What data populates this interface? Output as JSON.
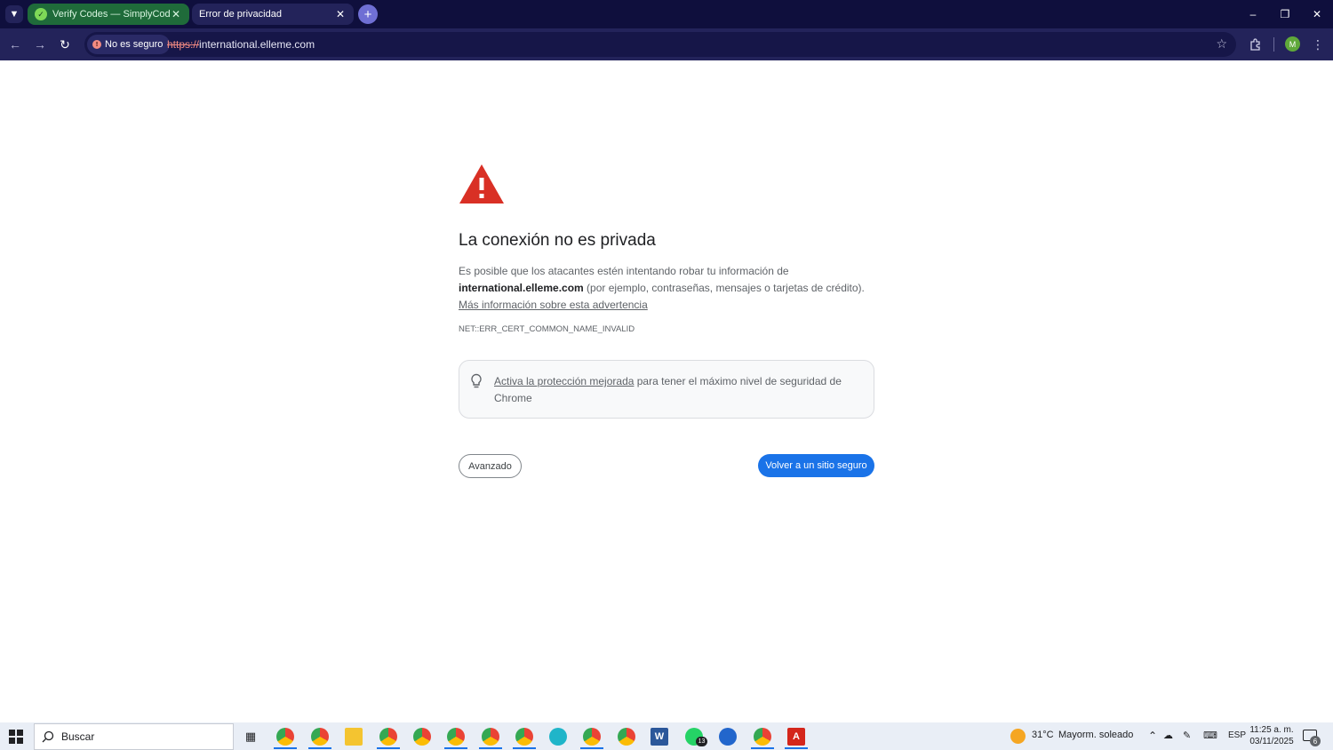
{
  "browser": {
    "tabs": [
      {
        "title": "Verify Codes — SimplyCodes",
        "favicon": "simplycodes-check-icon",
        "active": false
      },
      {
        "title": "Error de privacidad",
        "favicon": "",
        "active": true
      }
    ],
    "security_chip": "No es seguro",
    "url_scheme": "https://",
    "url_host": "international.elleme.com",
    "profile_initial": "M"
  },
  "page": {
    "heading": "La conexión no es privada",
    "desc_part1": "Es posible que los atacantes estén intentando robar tu información de ",
    "desc_host": "international.elleme.com",
    "desc_part2": " (por ejemplo, contraseñas, mensajes o tarjetas de crédito). ",
    "desc_link": "Más información sobre esta advertencia",
    "error_code": "NET::ERR_CERT_COMMON_NAME_INVALID",
    "protection_link": "Activa la protección mejorada",
    "protection_text": " para tener el máximo nivel de seguridad de Chrome",
    "advanced_button": "Avanzado",
    "back_button": "Volver a un sitio seguro"
  },
  "taskbar": {
    "search_placeholder": "Buscar",
    "weather": "31°C",
    "weather_desc": "Mayorm. soleado",
    "language": "ESP",
    "time": "11:25 a. m.",
    "date": "03/11/2025",
    "notifications": "6",
    "whatsapp_badge": "13"
  },
  "colors": {
    "tabbar": "#0f0f3d",
    "toolbar": "#23235a",
    "warning_red": "#d93025",
    "primary_blue": "#1a73e8"
  }
}
